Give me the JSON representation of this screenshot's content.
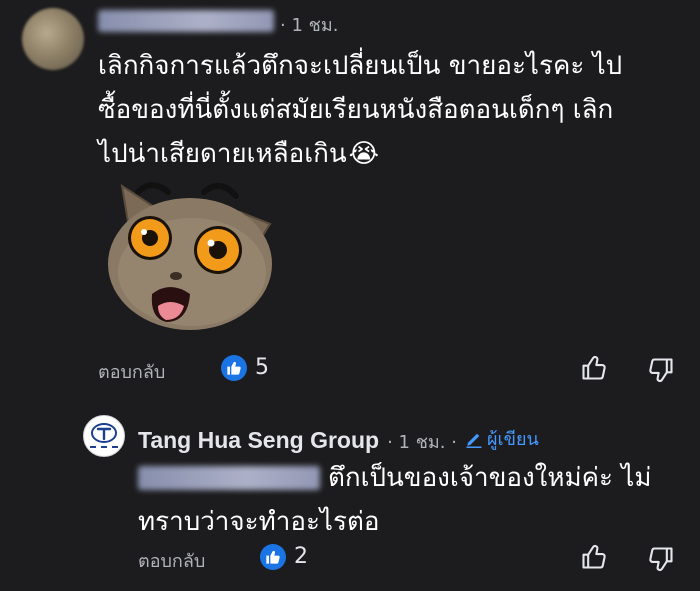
{
  "comment": {
    "time": "· 1 ชม.",
    "lines": [
      "เลิกกิจการแล้วตึกจะเปลี่ยนเป็น ขายอะไรคะ ไป",
      "ซื้อของที่นี่ตั้งแต่สมัยเรียนหนังสือตอนเด็กๆ เลิก",
      "ไปน่าเสียดายเหลือเกิน"
    ],
    "emoji": "😭",
    "reply_label": "ตอบกลับ",
    "like_count": "5"
  },
  "reply": {
    "author": "Tang Hua Seng Group",
    "time": "· 1 ชม. ·",
    "author_badge": "ผู้เขียน",
    "lines": [
      "ตึกเป็นของเจ้าของใหม่ค่ะ ไม่",
      "ทราบว่าจะทำอะไรต่อ"
    ],
    "reply_label": "ตอบกลับ",
    "like_count": "2"
  },
  "colors": {
    "background": "#1c1c1e",
    "like_blue": "#1b74e4",
    "author_badge": "#4599ff",
    "secondary_text": "#b0b3b8"
  },
  "icons": [
    "like-reaction-icon",
    "thumbs-up-outline-icon",
    "thumbs-down-outline-icon",
    "pencil-icon",
    "crying-face-emoji"
  ]
}
